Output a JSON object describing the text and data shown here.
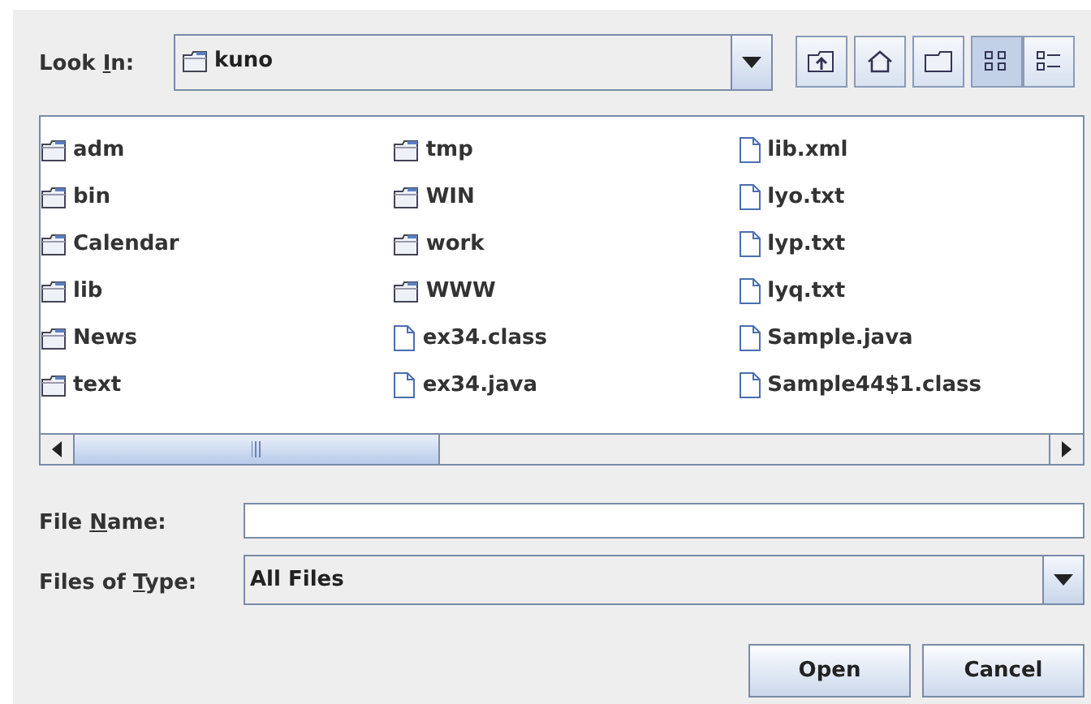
{
  "look_in": {
    "label": {
      "before": "Look ",
      "key": "I",
      "after": "n:"
    },
    "value": "kuno"
  },
  "toolbar": [
    {
      "kind": "up",
      "selected": false
    },
    {
      "kind": "home",
      "selected": false
    },
    {
      "kind": "new-folder",
      "selected": false
    },
    {
      "kind": "list",
      "selected": true
    },
    {
      "kind": "details",
      "selected": false
    }
  ],
  "files": [
    {
      "name": "adm",
      "kind": "folder"
    },
    {
      "name": "bin",
      "kind": "folder"
    },
    {
      "name": "Calendar",
      "kind": "folder"
    },
    {
      "name": "lib",
      "kind": "folder"
    },
    {
      "name": "News",
      "kind": "folder"
    },
    {
      "name": "text",
      "kind": "folder"
    },
    {
      "name": "tmp",
      "kind": "folder"
    },
    {
      "name": "WIN",
      "kind": "folder"
    },
    {
      "name": "work",
      "kind": "folder"
    },
    {
      "name": "WWW",
      "kind": "folder"
    },
    {
      "name": "ex34.class",
      "kind": "file"
    },
    {
      "name": "ex34.java",
      "kind": "file"
    },
    {
      "name": "lib.xml",
      "kind": "file"
    },
    {
      "name": "lyo.txt",
      "kind": "file"
    },
    {
      "name": "lyp.txt",
      "kind": "file"
    },
    {
      "name": "lyq.txt",
      "kind": "file"
    },
    {
      "name": "Sample.java",
      "kind": "file"
    },
    {
      "name": "Sample44$1.class",
      "kind": "file"
    }
  ],
  "file_name": {
    "label": {
      "before": "File ",
      "key": "N",
      "after": "ame:"
    }
  },
  "file_type": {
    "label": {
      "before": "Files of ",
      "key": "T",
      "after": "ype:"
    },
    "value": "All Files"
  },
  "buttons": [
    "Open",
    "Cancel"
  ]
}
